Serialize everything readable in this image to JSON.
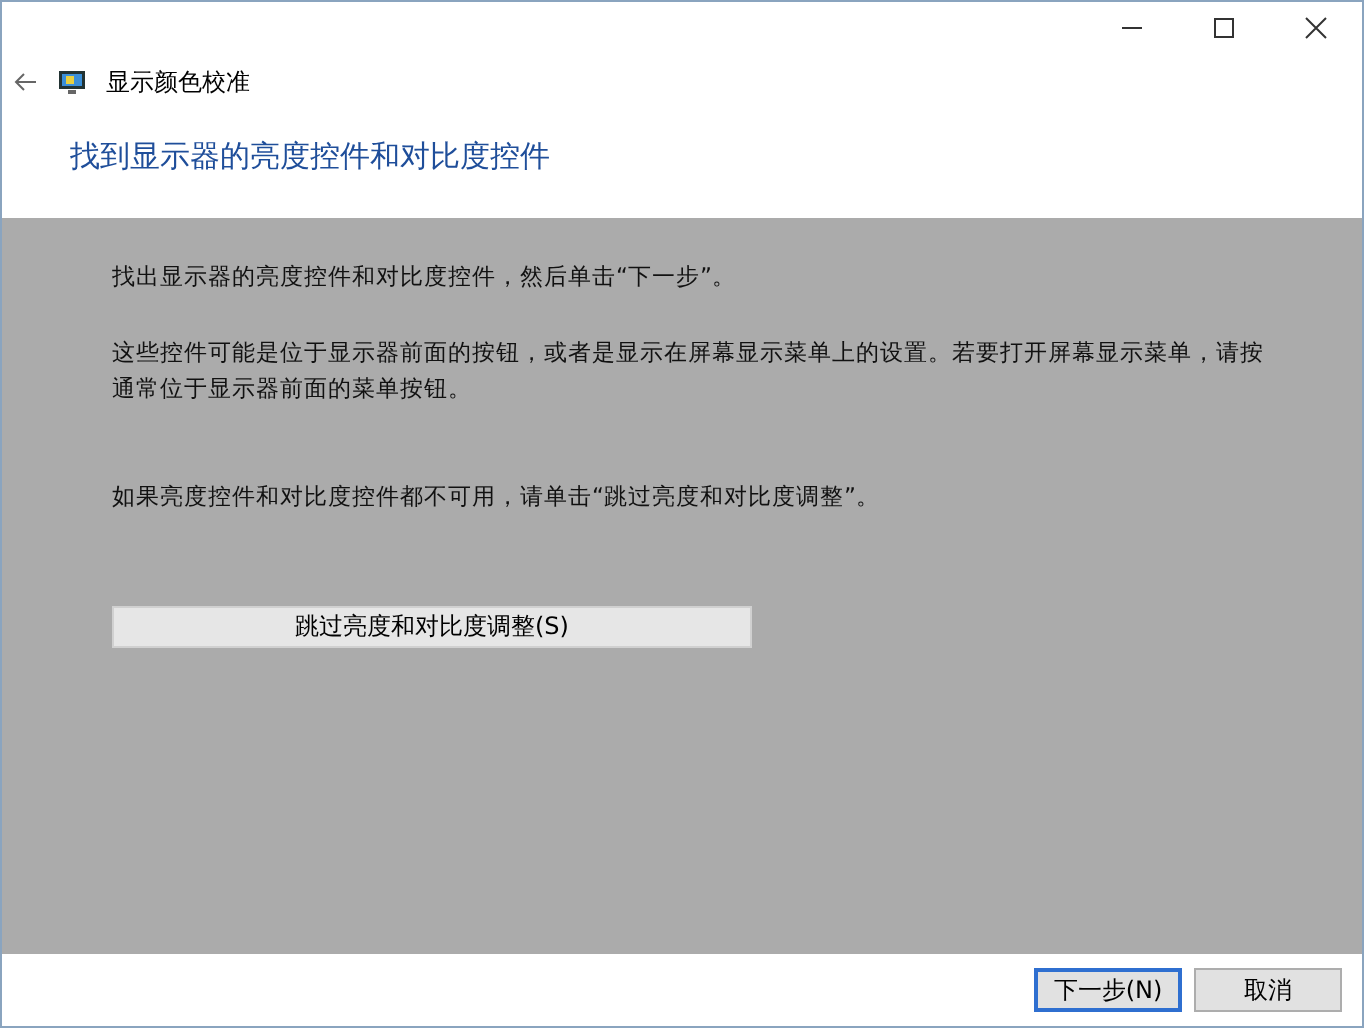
{
  "window": {
    "title": "显示颜色校准"
  },
  "heading": "找到显示器的亮度控件和对比度控件",
  "paragraphs": [
    "找出显示器的亮度控件和对比度控件，然后单击“下一步”。",
    "这些控件可能是位于显示器前面的按钮，或者是显示在屏幕显示菜单上的设置。若要打开屏幕显示菜单，请按通常位于显示器前面的菜单按钮。",
    "如果亮度控件和对比度控件都不可用，请单击“跳过亮度和对比度调整”。"
  ],
  "skip_button": "跳过亮度和对比度调整(S)",
  "buttons": [
    {
      "label": "下一步(N)",
      "default": true
    },
    {
      "label": "取消",
      "default": false
    }
  ]
}
